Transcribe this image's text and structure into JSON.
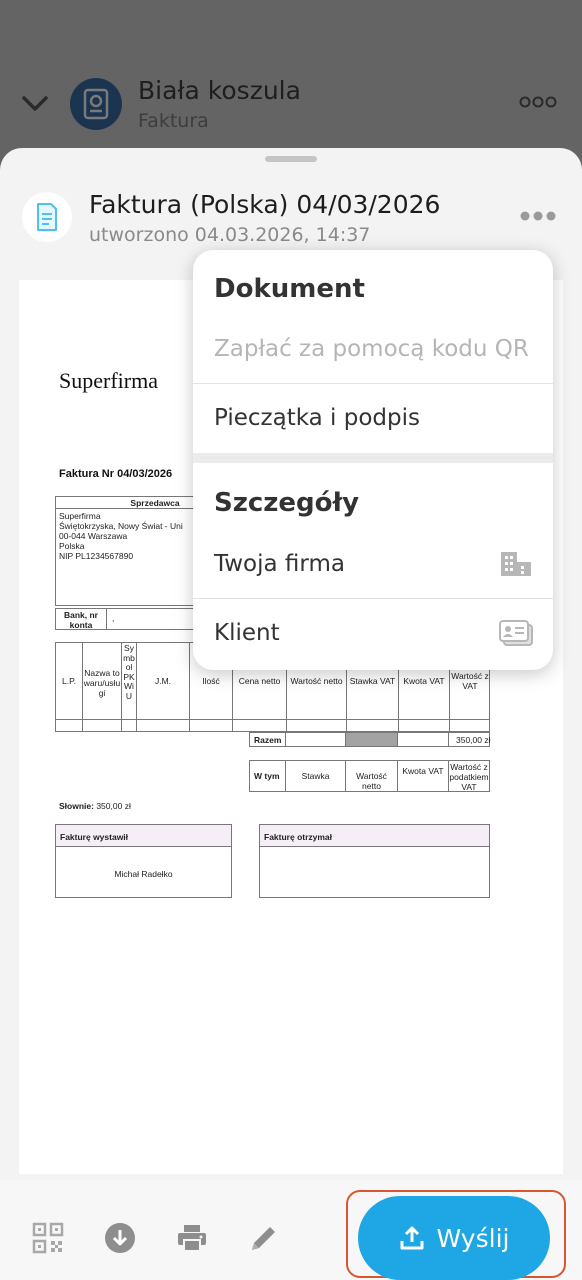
{
  "background": {
    "contact_name": "Biała koszula",
    "contact_type": "Faktura"
  },
  "document": {
    "title": "Faktura (Polska) 04/03/2026",
    "created": "utworzono 04.03.2026, 14:37"
  },
  "preview": {
    "company": "Superfirma",
    "invoice_no": "Faktura Nr 04/03/2026",
    "seller_header": "Sprzedawca",
    "seller_lines": [
      "Superfirma",
      "Świętokrzyska, Nowy Świat - Uni",
      "00-044 Warszawa",
      "Polska",
      "NIP PL1234567890"
    ],
    "bank_label": "Bank, nr konta",
    "bank_value": ",",
    "columns": [
      "L.P.",
      "Nazwa towaru/usługi",
      "Symbol PKWiU",
      "J.M.",
      "Ilość",
      "Cena netto",
      "Wartość netto",
      "Stawka VAT",
      "Kwota VAT",
      "Wartość z VAT"
    ],
    "total_label": "Razem",
    "total_value": "350,00 zł",
    "including_label": "W tym",
    "including_cols": [
      "Stawka",
      "Wartość netto",
      "Kwota VAT",
      "Wartość z podatkiem VAT"
    ],
    "in_words_label": "Słownie:",
    "in_words_value": "350,00 zł",
    "issued_by_label": "Fakturę wystawił",
    "issued_by_name": "Michał Radełko",
    "received_by_label": "Fakturę otrzymał"
  },
  "menu": {
    "section1": "Dokument",
    "qr_pay": "Zapłać za pomocą kodu QR",
    "stamp_sign": "Pieczątka i podpis",
    "section2": "Szczegóły",
    "your_company": "Twoja firma",
    "client": "Klient"
  },
  "toolbar": {
    "send_label": "Wyślij"
  },
  "colors": {
    "accent": "#1ea7e4",
    "highlight_outline": "#d9572f",
    "avatar": "#1b3550"
  }
}
